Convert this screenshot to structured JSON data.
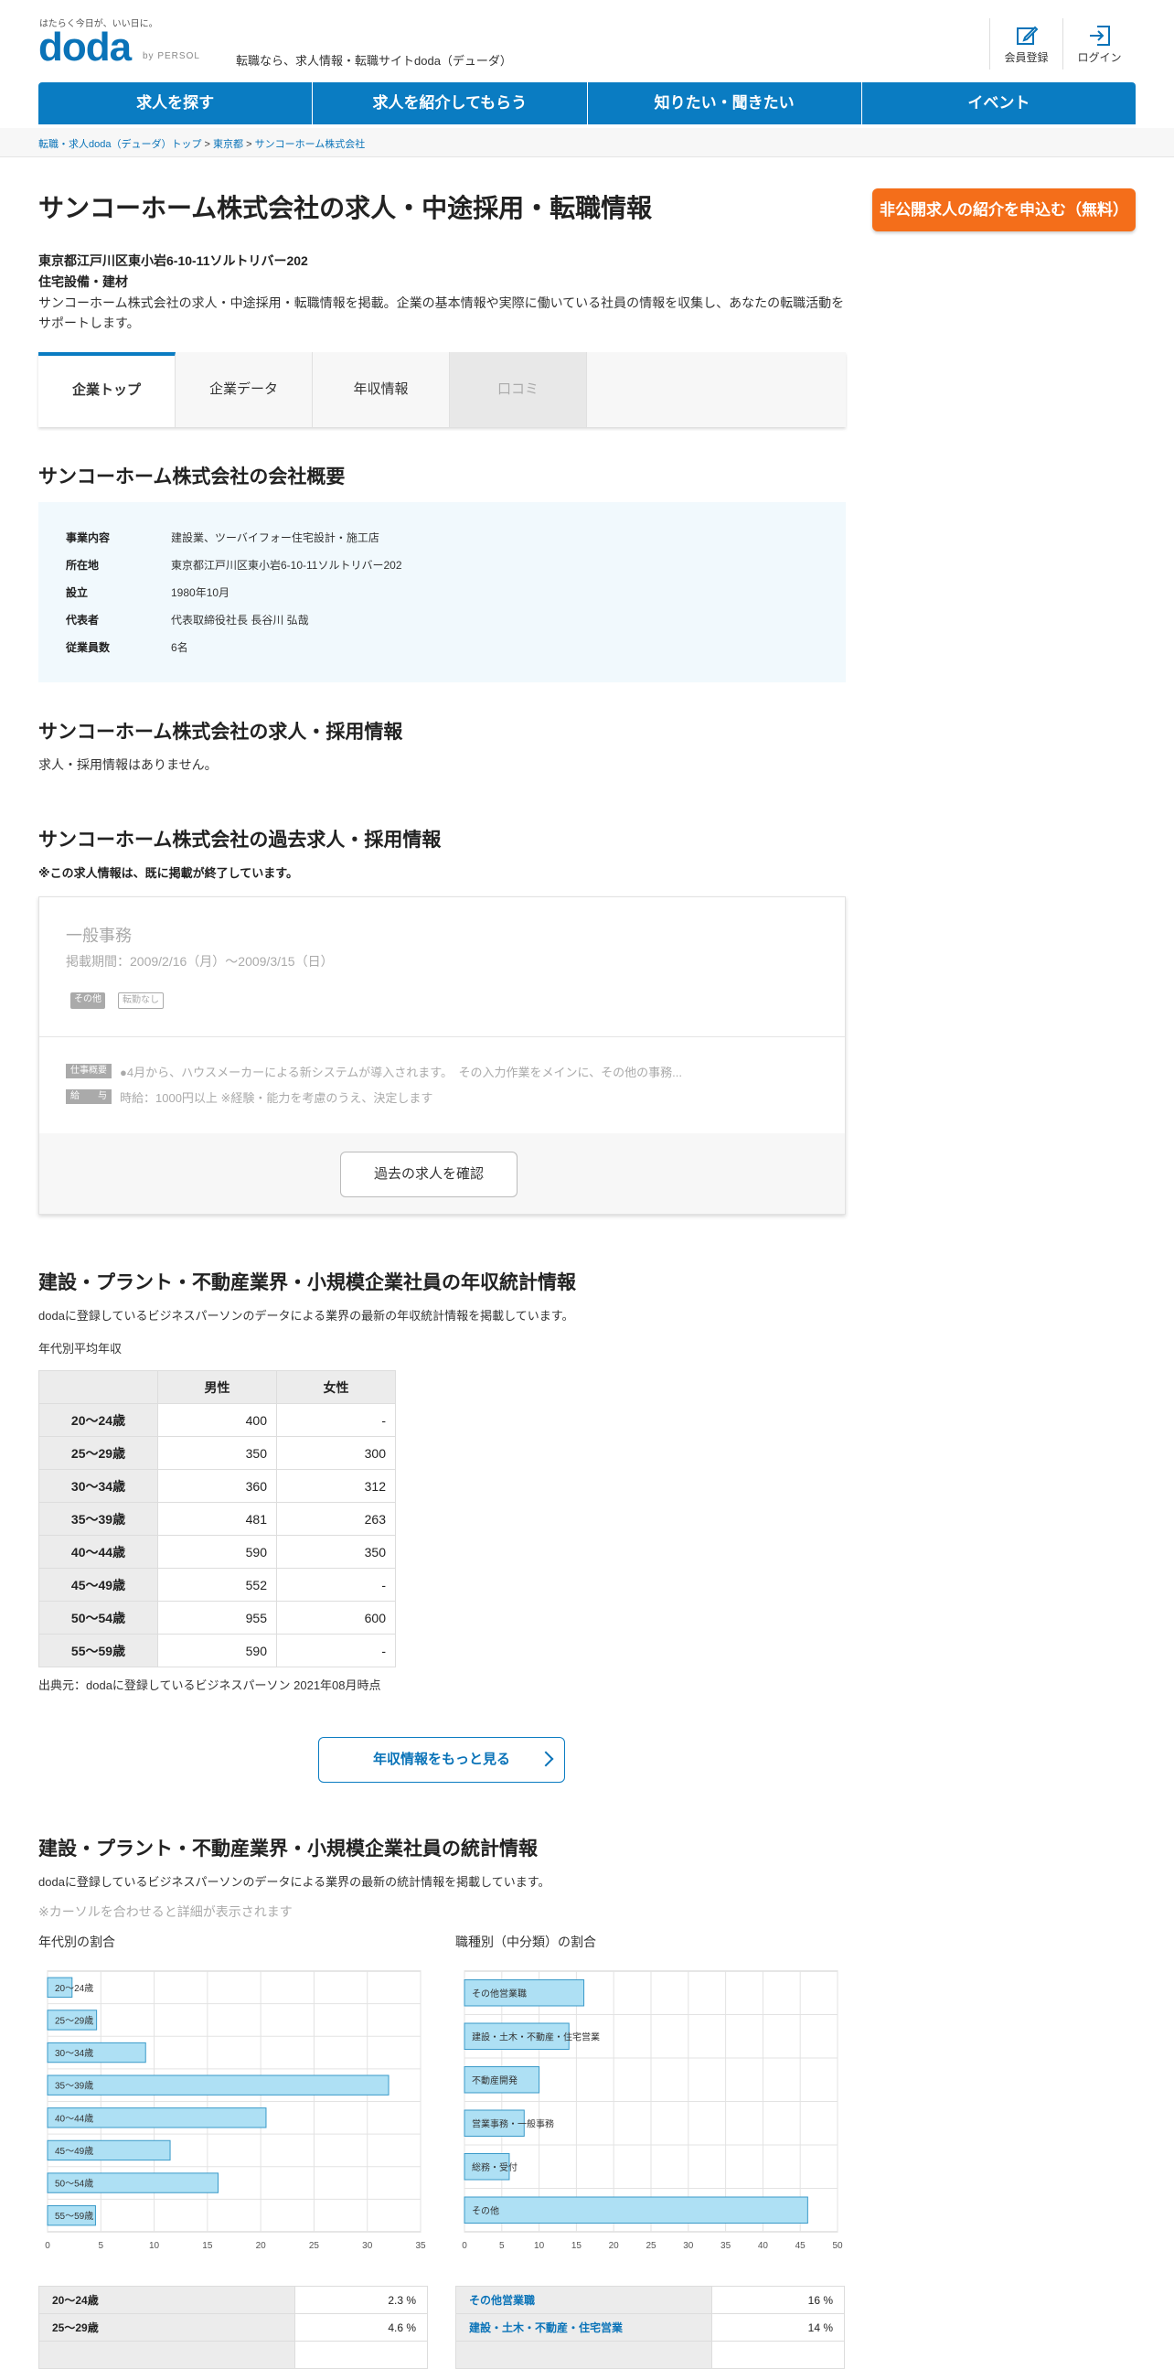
{
  "header": {
    "logo_tagline": "はたらく今日が、いい日に。",
    "logo": "doda",
    "logo_by": "by PERSOL",
    "site_tagline": "転職なら、求人情報・転職サイトdoda（デューダ）",
    "register_label": "会員登録",
    "login_label": "ログイン"
  },
  "nav": [
    "求人を探す",
    "求人を紹介してもらう",
    "知りたい・聞きたい",
    "イベント"
  ],
  "breadcrumb": [
    "転職・求人doda（デューダ）トップ",
    "東京都",
    "サンコーホーム株式会社"
  ],
  "page": {
    "title": "サンコーホーム株式会社の求人・中途採用・転職情報",
    "cta_label": "非公開求人の紹介を申込む（無料）",
    "address": "東京都江戸川区東小岩6-10-11ソルトリバー202",
    "industry": "住宅設備・建材",
    "description": "サンコーホーム株式会社の求人・中途採用・転職情報を掲載。企業の基本情報や実際に働いている社員の情報を収集し、あなたの転職活動をサポートします。"
  },
  "tabs": [
    "企業トップ",
    "企業データ",
    "年収情報",
    "口コミ"
  ],
  "overview": {
    "heading": "サンコーホーム株式会社の会社概要",
    "rows": [
      {
        "k": "事業内容",
        "v": "建設業、ツーバイフォー住宅設計・施工店"
      },
      {
        "k": "所在地",
        "v": "東京都江戸川区東小岩6-10-11ソルトリバー202"
      },
      {
        "k": "設立",
        "v": "1980年10月"
      },
      {
        "k": "代表者",
        "v": "代表取締役社長 長谷川 弘哉"
      },
      {
        "k": "従業員数",
        "v": "6名"
      }
    ]
  },
  "jobs": {
    "heading": "サンコーホーム株式会社の求人・採用情報",
    "empty": "求人・採用情報はありません。"
  },
  "past": {
    "heading": "サンコーホーム株式会社の過去求人・採用情報",
    "notice": "※この求人情報は、既に掲載が終了しています。",
    "job_title": "一般事務",
    "period": "掲載期間：2009/2/16（月）～2009/3/15（日）",
    "tag1": "その他",
    "tag2": "転勤なし",
    "label_work": "仕事概要",
    "work": "●4月から、ハウスメーカーによる新システムが導入されます。　その入力作業をメインに、その他の事務...",
    "label_pay": "給　　与",
    "pay": "時給：1000円以上 ※経験・能力を考慮のうえ、決定します",
    "button": "過去の求人を確認"
  },
  "salary": {
    "heading": "建設・プラント・不動産業界・小規模企業社員の年収統計情報",
    "desc": "dodaに登録しているビジネスパーソンのデータによる業界の最新の年収統計情報を掲載しています。",
    "caption": "年代別平均年収",
    "cols": [
      "男性",
      "女性"
    ],
    "rows": [
      {
        "age": "20～24歳",
        "m": "400",
        "f": "-"
      },
      {
        "age": "25～29歳",
        "m": "350",
        "f": "300"
      },
      {
        "age": "30～34歳",
        "m": "360",
        "f": "312"
      },
      {
        "age": "35～39歳",
        "m": "481",
        "f": "263"
      },
      {
        "age": "40～44歳",
        "m": "590",
        "f": "350"
      },
      {
        "age": "45～49歳",
        "m": "552",
        "f": "-"
      },
      {
        "age": "50～54歳",
        "m": "955",
        "f": "600"
      },
      {
        "age": "55～59歳",
        "m": "590",
        "f": "-"
      }
    ],
    "source": "出典元：dodaに登録しているビジネスパーソン 2021年08月時点",
    "more": "年収情報をもっと見る"
  },
  "stats": {
    "heading": "建設・プラント・不動産業界・小規模企業社員の統計情報",
    "desc": "dodaに登録しているビジネスパーソンのデータによる業界の最新の統計情報を掲載しています。",
    "hover_note": "※カーソルを合わせると詳細が表示されます",
    "age_title": "年代別の割合",
    "job_title": "職種別（中分類）の割合",
    "age_rows": [
      {
        "k": "20～24歳",
        "v": "2.3 %"
      },
      {
        "k": "25～29歳",
        "v": "4.6 %"
      }
    ],
    "job_rows": [
      {
        "k": "その他営業職",
        "v": "16 %"
      },
      {
        "k": "建設・土木・不動産・住宅営業",
        "v": "14 %"
      }
    ]
  },
  "chart_data": [
    {
      "type": "bar",
      "orientation": "horizontal",
      "title": "年代別の割合",
      "categories": [
        "20～24歳",
        "25～29歳",
        "30～34歳",
        "35～39歳",
        "40～44歳",
        "45～49歳",
        "50～54歳",
        "55～59歳"
      ],
      "values": [
        2.3,
        4.6,
        9.2,
        32,
        20.5,
        11.5,
        16,
        4.5
      ],
      "xlim": [
        0,
        35
      ],
      "xticks": [
        "0",
        "5",
        "10",
        "15",
        "20",
        "25",
        "30",
        "35"
      ],
      "grid": true,
      "color": "#aee0f4"
    },
    {
      "type": "bar",
      "orientation": "horizontal",
      "title": "職種別（中分類）の割合",
      "categories": [
        "その他営業職",
        "建設・土木・不動産・住宅営業",
        "不動産開発",
        "営業事務・一般事務",
        "総務・受付",
        "その他"
      ],
      "values": [
        16,
        14,
        10,
        8,
        6,
        46
      ],
      "xlim": [
        0,
        50
      ],
      "xticks": [
        "0",
        "5",
        "10",
        "15",
        "20",
        "25",
        "30",
        "35",
        "40",
        "45",
        "50"
      ],
      "grid": true,
      "color": "#aee0f4"
    }
  ]
}
